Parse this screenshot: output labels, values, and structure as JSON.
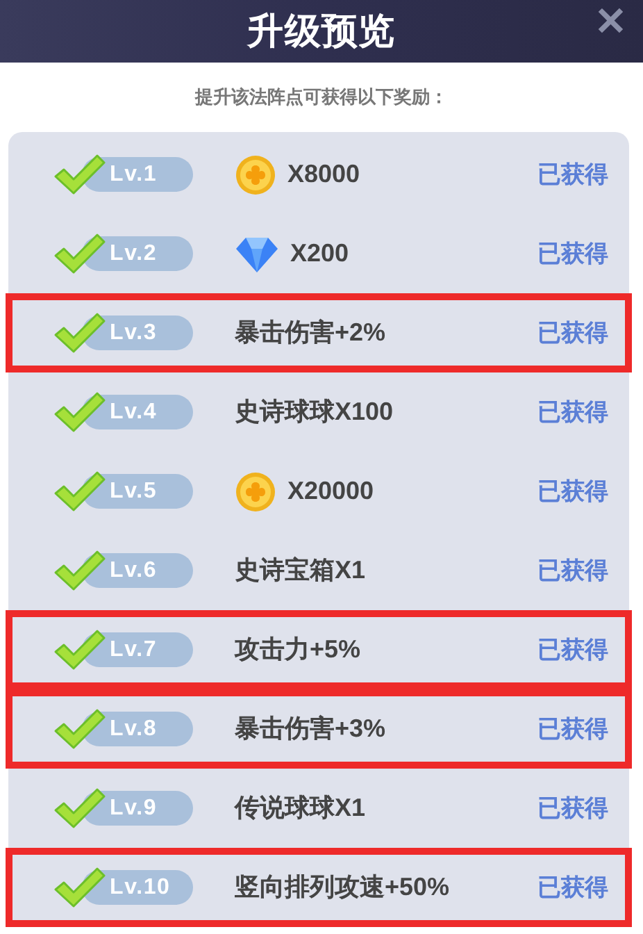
{
  "window": {
    "title": "升级预览",
    "close": "✕"
  },
  "subtitle": "提升该法阵点可获得以下奖励：",
  "rewards": [
    {
      "level": "Lv.1",
      "kind": "coin",
      "text": "X8000",
      "status": "已获得",
      "highlighted": false
    },
    {
      "level": "Lv.2",
      "kind": "gem",
      "text": "X200",
      "status": "已获得",
      "highlighted": false
    },
    {
      "level": "Lv.3",
      "kind": "text",
      "text": "暴击伤害+2%",
      "status": "已获得",
      "highlighted": true
    },
    {
      "level": "Lv.4",
      "kind": "text",
      "text": "史诗球球X100",
      "status": "已获得",
      "highlighted": false
    },
    {
      "level": "Lv.5",
      "kind": "coin",
      "text": "X20000",
      "status": "已获得",
      "highlighted": false
    },
    {
      "level": "Lv.6",
      "kind": "text",
      "text": "史诗宝箱X1",
      "status": "已获得",
      "highlighted": false
    },
    {
      "level": "Lv.7",
      "kind": "text",
      "text": "攻击力+5%",
      "status": "已获得",
      "highlighted": true
    },
    {
      "level": "Lv.8",
      "kind": "text",
      "text": "暴击伤害+3%",
      "status": "已获得",
      "highlighted": true
    },
    {
      "level": "Lv.9",
      "kind": "text",
      "text": "传说球球X1",
      "status": "已获得",
      "highlighted": false
    },
    {
      "level": "Lv.10",
      "kind": "text",
      "text": "竖向排列攻速+50%",
      "status": "已获得",
      "highlighted": true
    }
  ]
}
